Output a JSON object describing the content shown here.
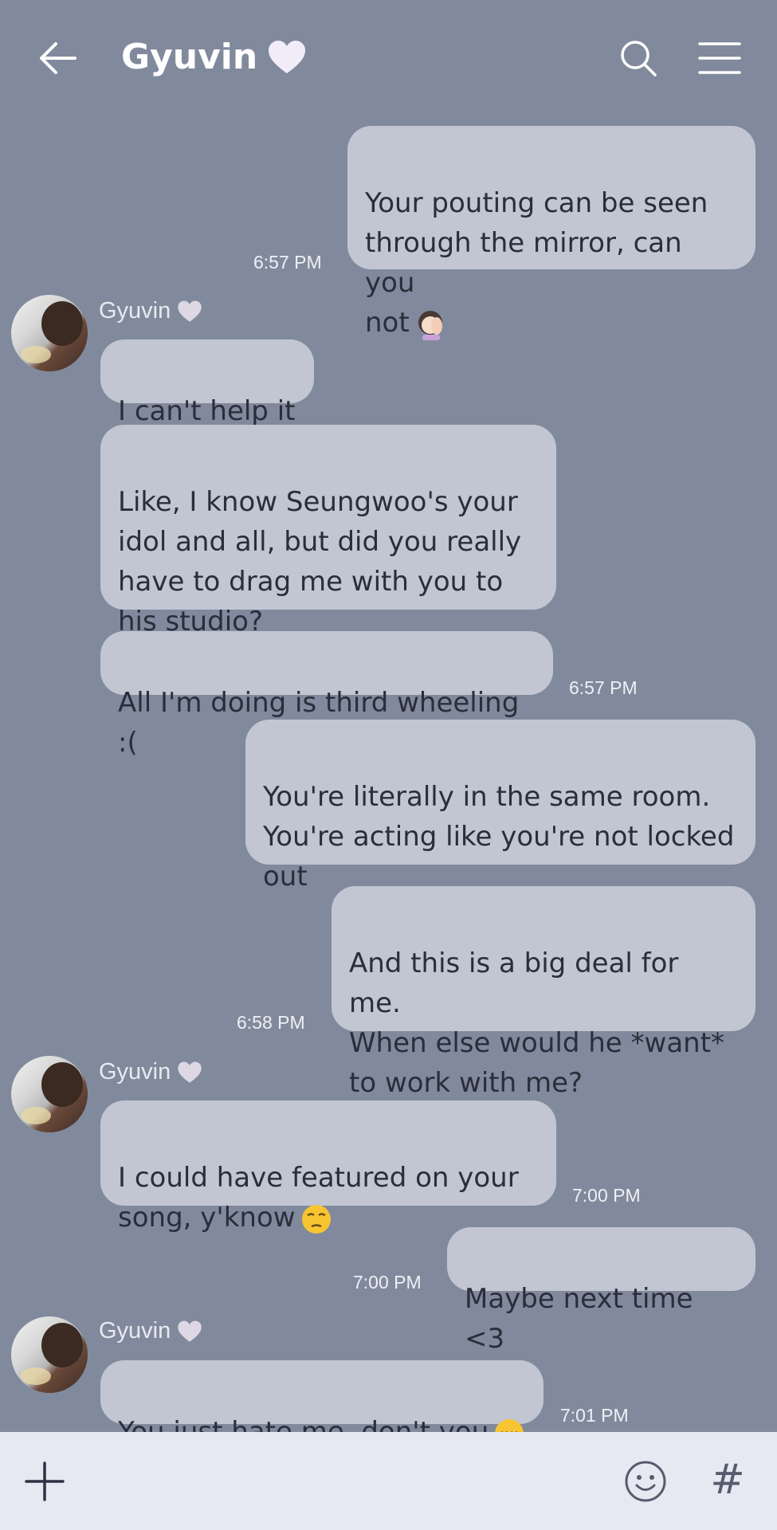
{
  "header": {
    "back_icon": "arrow-left-icon",
    "title": "Gyuvin",
    "title_icon": "white-heart-icon",
    "search_icon": "search-icon",
    "menu_icon": "hamburger-menu-icon"
  },
  "colors": {
    "background": "#818a9c",
    "bubble": "#c1c6d2",
    "input_bar": "#e6e9f2"
  },
  "messages": [
    {
      "side": "out",
      "text": "Your pouting can be seen\nthrough the mirror, can you\nnot",
      "emoji": "woman-facepalming-emoji",
      "time": "6:57 PM"
    },
    {
      "side": "in",
      "sender": "Gyuvin",
      "text": "I can't help it"
    },
    {
      "side": "in",
      "text": "Like, I know Seungwoo's your\nidol and all, but did you really\nhave to drag me with you to\nhis studio?"
    },
    {
      "side": "in",
      "text": "All I'm doing is third wheeling :(",
      "time": "6:57 PM"
    },
    {
      "side": "out",
      "text": "You're literally in the same room.\nYou're acting like you're not locked\nout"
    },
    {
      "side": "out",
      "text": "And this is a big deal for me.\nWhen else would he *want*\nto work with me?",
      "time": "6:58 PM"
    },
    {
      "side": "in",
      "sender": "Gyuvin",
      "text": "I could have featured on your\nsong, y'know",
      "emoji": "unamused-face-emoji",
      "time": "7:00 PM"
    },
    {
      "side": "out",
      "text": "Maybe next time <3",
      "time": "7:00 PM"
    },
    {
      "side": "in",
      "sender": "Gyuvin",
      "text": "You just hate me, don't you",
      "emoji": "pensive-face-emoji",
      "time": "7:01 PM"
    }
  ],
  "input_bar": {
    "plus_icon": "plus-icon",
    "emoji_icon": "smiley-icon",
    "hashtag_label": "#"
  }
}
